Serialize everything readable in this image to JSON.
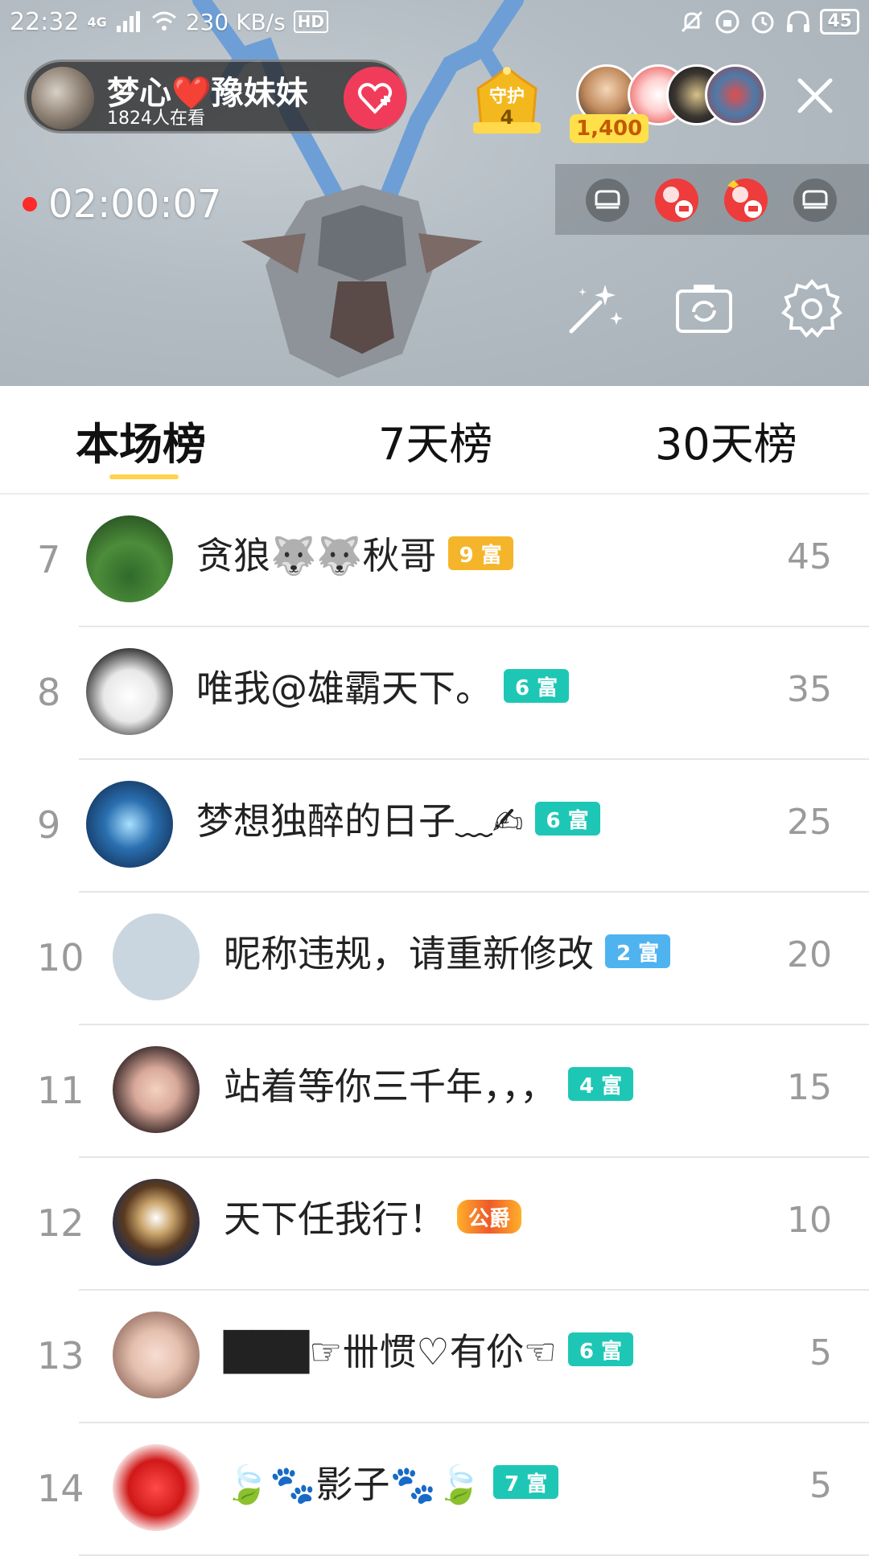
{
  "status_bar": {
    "time": "22:32",
    "network": "4G",
    "speed": "230 KB/s",
    "hd": "HD",
    "battery": "45"
  },
  "live": {
    "anchor_name": "梦心❤️豫妹妹",
    "viewers": "1824人在看",
    "guard_label": "守护",
    "guard_count": "4",
    "audience_count": "1,400",
    "duration": "02:00:07"
  },
  "tabs": [
    {
      "label": "本场榜",
      "active": true
    },
    {
      "label": "7天榜",
      "active": false
    },
    {
      "label": "30天榜",
      "active": false
    }
  ],
  "rankings": [
    {
      "rank": "7",
      "name": "贪狼🐺🐺秋哥",
      "badge": "9 富",
      "badge_color": "#f5b52a",
      "score": "45"
    },
    {
      "rank": "8",
      "name": "唯我@雄霸天下。",
      "badge": "6 富",
      "badge_color": "#1ec7b5",
      "score": "35"
    },
    {
      "rank": "9",
      "name": "梦想独醉的日子﹏✍",
      "badge": "6 富",
      "badge_color": "#1ec7b5",
      "score": "25"
    },
    {
      "rank": "10",
      "name": "昵称违规，请重新修改",
      "badge": "2 富",
      "badge_color": "#4fb3f0",
      "score": "20"
    },
    {
      "rank": "11",
      "name": "站着等你三千年，，，",
      "badge": "4 富",
      "badge_color": "#1ec7b5",
      "score": "15"
    },
    {
      "rank": "12",
      "name": "天下任我行！",
      "badge": "公爵",
      "badge_color": "#ef5a2a",
      "score": "10"
    },
    {
      "rank": "13",
      "name": "███☞卌惯♡有伱☜",
      "badge": "6 富",
      "badge_color": "#1ec7b5",
      "score": "5"
    },
    {
      "rank": "14",
      "name": "🍃🐾影子🐾🍃",
      "badge": "7 富",
      "badge_color": "#1ec7b5",
      "score": "5"
    }
  ],
  "colors": {
    "tab_underline": "#ffd34c",
    "follow_button": "#f03c5a",
    "rank_text": "#9a9a9a"
  }
}
